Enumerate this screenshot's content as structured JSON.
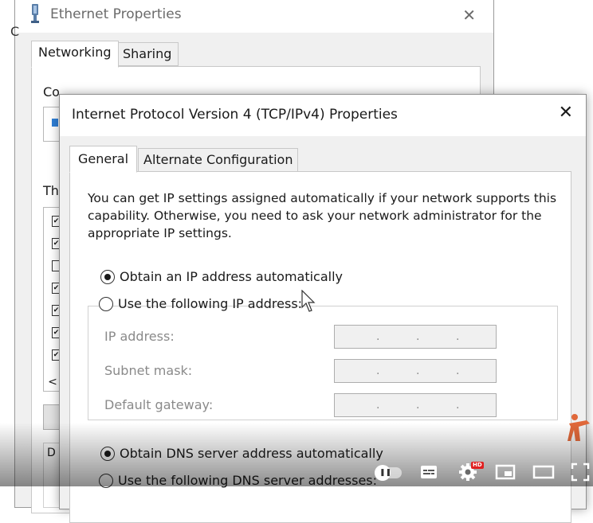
{
  "ethernet_window": {
    "title": "Ethernet Properties",
    "close_glyph": "✕",
    "tabs": [
      {
        "label": "Networking",
        "active": true
      },
      {
        "label": "Sharing",
        "active": false
      }
    ],
    "connect_using_label": "Co",
    "this_connection_label": "Th",
    "list_scroll_glyph": "<",
    "list_items": [
      {
        "checked": true
      },
      {
        "checked": true
      },
      {
        "checked": false
      },
      {
        "checked": true
      },
      {
        "checked": true
      },
      {
        "checked": true
      },
      {
        "checked": true
      }
    ],
    "description_mark": "D",
    "left_edge_text": "C"
  },
  "ipv4_dialog": {
    "title": "Internet Protocol Version 4 (TCP/IPv4) Properties",
    "close_glyph": "✕",
    "tabs": [
      {
        "label": "General",
        "active": true
      },
      {
        "label": "Alternate Configuration",
        "active": false
      }
    ],
    "intro_text": "You can get IP settings assigned automatically if your network supports this capability. Otherwise, you need to ask your network administrator for the appropriate IP settings.",
    "ip_mode": {
      "auto_label": "Obtain an IP address automatically",
      "manual_label": "Use the following IP address:",
      "selected": "auto"
    },
    "ip_fields": {
      "ip_address_label": "IP address:",
      "subnet_mask_label": "Subnet mask:",
      "default_gateway_label": "Default gateway:",
      "dot": "."
    },
    "dns_mode": {
      "auto_label": "Obtain DNS server address automatically",
      "manual_label": "Use the following DNS server addresses:",
      "selected": "auto"
    }
  },
  "player": {
    "hd_badge": "HD",
    "icons": [
      "autoplay-toggle-icon",
      "subtitles-icon",
      "settings-icon",
      "miniplayer-icon",
      "theater-mode-icon",
      "fullscreen-icon"
    ]
  },
  "colors": {
    "dialog_bg": "#f0f0f0",
    "panel_bg": "#ffffff",
    "disabled_text": "#8a8a8a",
    "hd_badge": "#e02020",
    "watermark": "#e0683a"
  }
}
